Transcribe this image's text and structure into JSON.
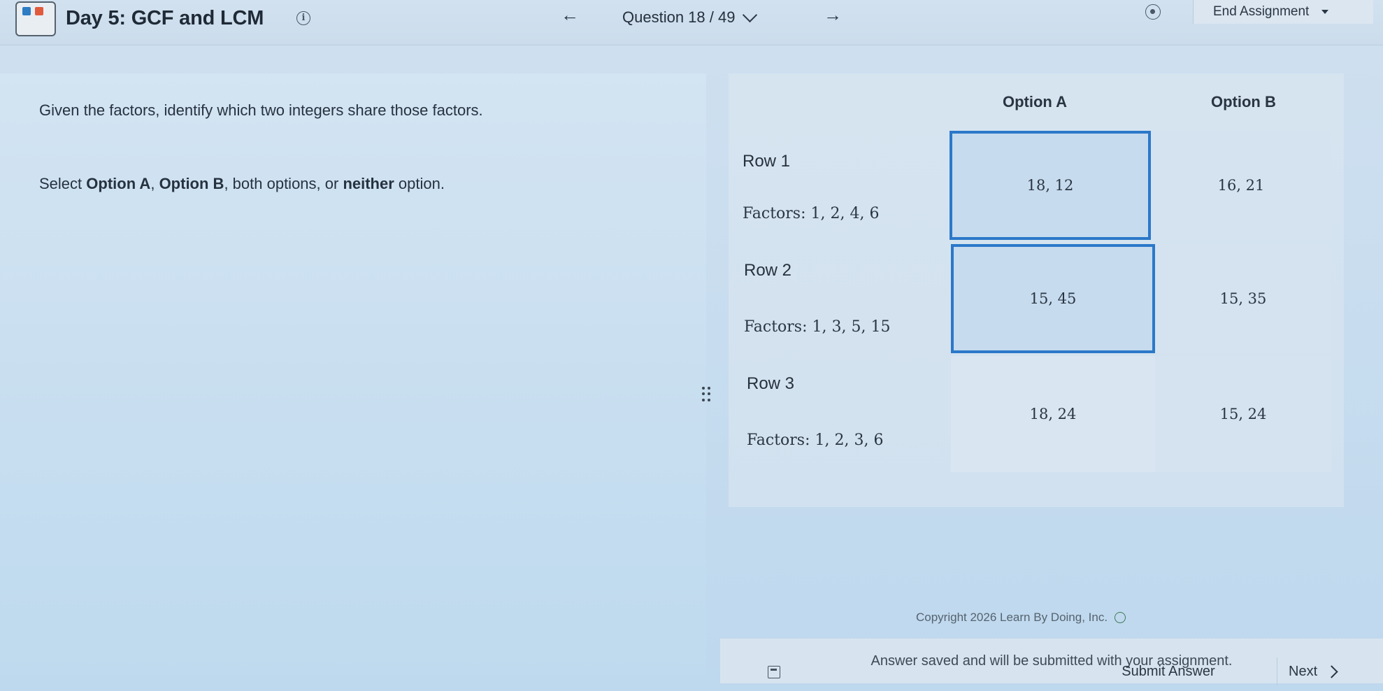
{
  "header": {
    "assignment_title": "Day 5: GCF and LCM",
    "info_glyph": "i",
    "prev_arrow": "←",
    "question_counter": "Question 18 / 49",
    "next_arrow": "→",
    "end_assignment_label": "End Assignment"
  },
  "prompt": {
    "line1": "Given the factors, identify which two integers share those factors.",
    "line2_prefix": "Select ",
    "line2_opt_a": "Option A",
    "line2_sep1": ", ",
    "line2_opt_b": "Option B",
    "line2_mid": ", both options, or ",
    "line2_neither": "neither",
    "line2_suffix": " option."
  },
  "table": {
    "columns": [
      "Option A",
      "Option B"
    ],
    "rows": [
      {
        "label": "Row 1",
        "factors": "Factors: 1, 2, 4, 6",
        "option_a": "18, 12",
        "option_b": "16, 21",
        "selected": "A"
      },
      {
        "label": "Row 2",
        "factors": "Factors: 1, 3, 5, 15",
        "option_a": "15, 45",
        "option_b": "15, 35",
        "selected": "A"
      },
      {
        "label": "Row 3",
        "factors": "Factors: 1, 2, 3, 6",
        "option_a": "18, 24",
        "option_b": "15, 24",
        "selected": ""
      }
    ]
  },
  "footer": {
    "copyright": "Copyright 2026 Learn By Doing, Inc.",
    "save_status": "Answer saved and will be submitted with your assignment.",
    "submit_label": "Submit Answer",
    "next_label": "Next"
  },
  "colors": {
    "selection_border": "#2b78c9",
    "background": "#c9ddef"
  }
}
